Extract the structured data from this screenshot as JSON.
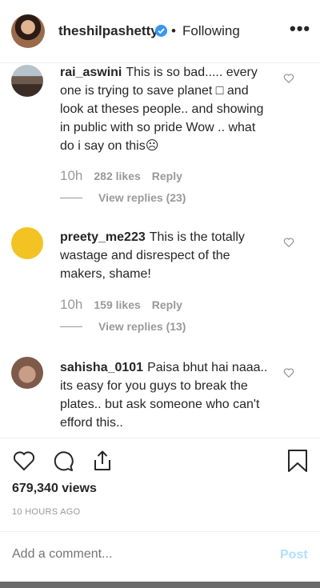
{
  "header": {
    "username": "theshilpashetty",
    "separator": "•",
    "follow_status": "Following",
    "more_label": "•••"
  },
  "comments": [
    {
      "username": "rai_aswini",
      "text": "This is so bad..... every one is trying to save planet □ and look at theses people.. and showing in public with so pride Wow .. what do i say on this☹",
      "time": "10h",
      "likes": "282 likes",
      "reply_label": "Reply",
      "view_replies": "View replies (23)"
    },
    {
      "username": "preety_me223",
      "text": "This is the totally wastage and disrespect of the makers, shame!",
      "time": "10h",
      "likes": "159 likes",
      "reply_label": "Reply",
      "view_replies": "View replies (13)"
    },
    {
      "username": "sahisha_0101",
      "text": "Paisa bhut hai naaa.. its easy for you guys to break the plates.. but ask someone who can't efford this.."
    }
  ],
  "post": {
    "views": "679,340 views",
    "time_ago": "10 HOURS AGO"
  },
  "comment_box": {
    "placeholder": "Add a comment...",
    "post_label": "Post"
  },
  "colors": {
    "verified_badge": "#3897f0",
    "muted_text": "#999999",
    "post_button": "#b2dffc"
  }
}
